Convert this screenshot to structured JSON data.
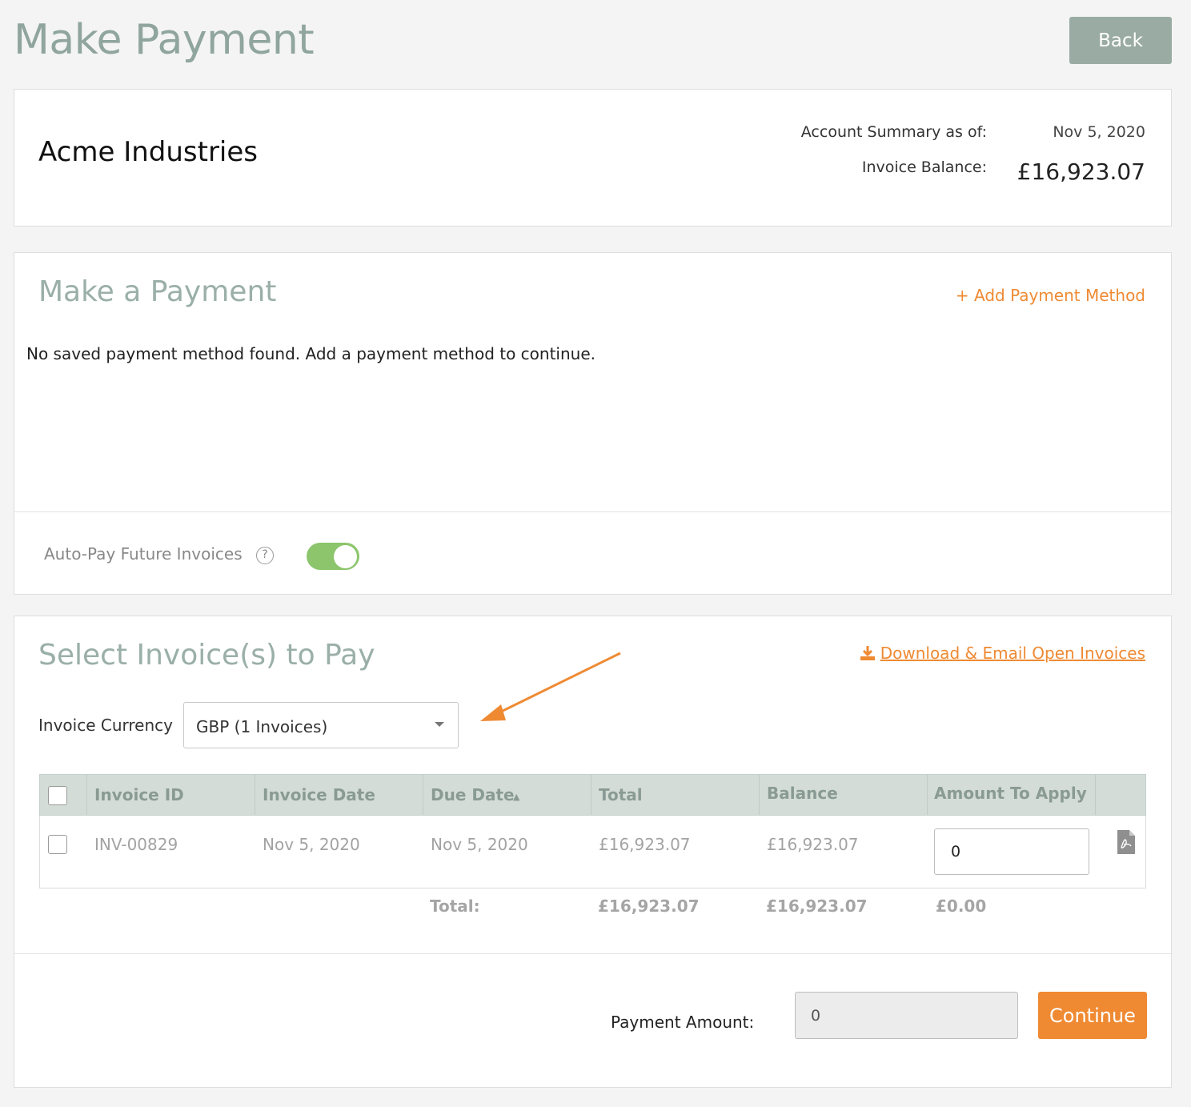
{
  "page": {
    "title": "Make Payment",
    "back_label": "Back"
  },
  "summary": {
    "account_name": "Acme Industries",
    "as_of_label": "Account Summary as of:",
    "as_of_date": "Nov 5, 2020",
    "balance_label": "Invoice Balance:",
    "balance_value": "£16,923.07"
  },
  "payment": {
    "title": "Make a Payment",
    "add_method": "+ Add Payment Method",
    "empty_message": "No saved payment method found. Add a payment method to continue.",
    "autopay_label": "Auto-Pay Future Invoices",
    "help_glyph": "?",
    "autopay_enabled": true
  },
  "invoices": {
    "title": "Select Invoice(s) to Pay",
    "download_link": "Download & Email Open Invoices",
    "currency_label": "Invoice Currency",
    "currency_value": "GBP (1 Invoices)",
    "columns": [
      "Invoice ID",
      "Invoice Date",
      "Due Date",
      "Total",
      "Balance",
      "Amount To Apply"
    ],
    "sort_indicator": "▲",
    "rows": [
      {
        "id": "INV-00829",
        "invoice_date": "Nov 5, 2020",
        "due_date": "Nov 5, 2020",
        "total": "£16,923.07",
        "balance": "£16,923.07",
        "amount": "0"
      }
    ],
    "totals": {
      "label": "Total:",
      "total": "£16,923.07",
      "balance": "£16,923.07",
      "amount": "£0.00"
    }
  },
  "footer": {
    "payment_amount_label": "Payment Amount:",
    "payment_amount_value": "0",
    "continue_label": "Continue"
  },
  "colors": {
    "accent_orange": "#ef8a33",
    "title_green_gray": "#8fa59d",
    "toggle_on": "#8cc56c",
    "table_header": "#d3dcd6"
  },
  "icons": [
    "help-icon",
    "download-icon",
    "dropdown-caret-icon",
    "sort-asc-icon",
    "pdf-icon",
    "annotation-arrow"
  ]
}
